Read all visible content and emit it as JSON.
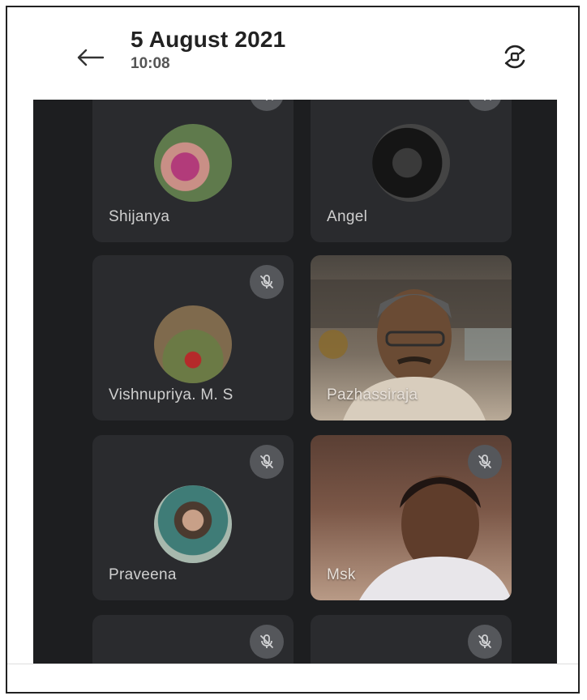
{
  "header": {
    "title": "5 August 2021",
    "subtitle": "10:08"
  },
  "participants": [
    {
      "name": "Shijanya",
      "muted": false
    },
    {
      "name": "Angel",
      "muted": false
    },
    {
      "name": "Vishnupriya. M. S",
      "muted": true
    },
    {
      "name": "Pazhassiraja",
      "muted": false
    },
    {
      "name": "Praveena",
      "muted": true
    },
    {
      "name": "Msk",
      "muted": true
    }
  ],
  "icons": [
    "arrow-left-icon",
    "rotate-screen-icon",
    "mic-off-icon"
  ],
  "colors": {
    "stage": "#1d1e20",
    "tile": "#2a2b2e",
    "mic_badge": "#55575b"
  }
}
